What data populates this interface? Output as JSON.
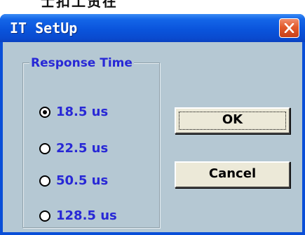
{
  "background_text": "士扣工贸在",
  "window": {
    "title": "IT SetUp",
    "close_icon": "close-x-icon",
    "colors": {
      "title_bar": "#0a54dc",
      "client_bg": "#b5c8d3",
      "label_text": "#2828d6",
      "close_button": "#e25a2c"
    }
  },
  "group": {
    "legend": "Response Time",
    "options": [
      {
        "label": "18.5 us",
        "selected": true
      },
      {
        "label": "22.5 us",
        "selected": false
      },
      {
        "label": "50.5 us",
        "selected": false
      },
      {
        "label": "128.5 us",
        "selected": false
      }
    ]
  },
  "buttons": {
    "ok": "OK",
    "cancel": "Cancel"
  }
}
